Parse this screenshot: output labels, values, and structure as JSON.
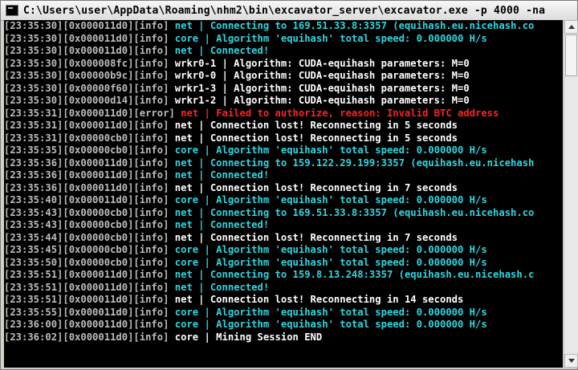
{
  "window": {
    "title": "C:\\Users\\user\\AppData\\Roaming\\nhm2\\bin\\excavator_server\\excavator.exe  -p 4000 -na"
  },
  "colors": {
    "cyan": "#2fd6e0",
    "white": "#ffffff",
    "red": "#ff2020",
    "grey": "#bdbdbd",
    "background": "#000000"
  },
  "lines": [
    {
      "prefix": "[23:35:30][0x000011d0][info]",
      "msg": "net | Connecting to 169.51.33.8:3357 (equihash.eu.nicehash.co",
      "color": "cyan"
    },
    {
      "prefix": "[23:35:30][0x000011d0][info]",
      "msg": "core | Algorithm 'equihash' total speed: 0.000000 H/s",
      "color": "cyan"
    },
    {
      "prefix": "[23:35:30][0x000011d0][info]",
      "msg": "net | Connected!",
      "color": "cyan"
    },
    {
      "prefix": "[23:35:30][0x000008fc][info]",
      "msg": "wrkr0-1 | Algorithm: CUDA-equihash parameters: M=0",
      "color": "white"
    },
    {
      "prefix": "[23:35:30][0x00000b9c][info]",
      "msg": "wrkr0-0 | Algorithm: CUDA-equihash parameters: M=0",
      "color": "white"
    },
    {
      "prefix": "[23:35:30][0x00000f60][info]",
      "msg": "wrkr1-3 | Algorithm: CUDA-equihash parameters: M=0",
      "color": "white"
    },
    {
      "prefix": "[23:35:30][0x00000d14][info]",
      "msg": "wrkr1-2 | Algorithm: CUDA-equihash parameters: M=0",
      "color": "white"
    },
    {
      "prefix": "[23:35:31][0x000011d0][error]",
      "msg": "net | Failed to authorize, reason: Invalid BTC address",
      "color": "red"
    },
    {
      "prefix": "[23:35:31][0x000011d0][info]",
      "msg": "net | Connection lost! Reconnecting in 5 seconds",
      "color": "white"
    },
    {
      "prefix": "[23:35:31][0x00000cb0][info]",
      "msg": "net | Connection lost! Reconnecting in 5 seconds",
      "color": "white"
    },
    {
      "prefix": "[23:35:35][0x00000cb0][info]",
      "msg": "core | Algorithm 'equihash' total speed: 0.000000 H/s",
      "color": "cyan"
    },
    {
      "prefix": "[23:35:36][0x000011d0][info]",
      "msg": "net | Connecting to 159.122.29.199:3357 (equihash.eu.nicehash",
      "color": "cyan"
    },
    {
      "prefix": "[23:35:36][0x000011d0][info]",
      "msg": "net | Connected!",
      "color": "cyan"
    },
    {
      "prefix": "[23:35:36][0x000011d0][info]",
      "msg": "net | Connection lost! Reconnecting in 7 seconds",
      "color": "white"
    },
    {
      "prefix": "[23:35:40][0x000011d0][info]",
      "msg": "core | Algorithm 'equihash' total speed: 0.000000 H/s",
      "color": "cyan"
    },
    {
      "prefix": "[23:35:43][0x00000cb0][info]",
      "msg": "net | Connecting to 169.51.33.8:3357 (equihash.eu.nicehash.co",
      "color": "cyan"
    },
    {
      "prefix": "[23:35:43][0x00000cb0][info]",
      "msg": "net | Connected!",
      "color": "cyan"
    },
    {
      "prefix": "[23:35:44][0x00000cb0][info]",
      "msg": "net | Connection lost! Reconnecting in 7 seconds",
      "color": "white"
    },
    {
      "prefix": "[23:35:45][0x00000cb0][info]",
      "msg": "core | Algorithm 'equihash' total speed: 0.000000 H/s",
      "color": "cyan"
    },
    {
      "prefix": "[23:35:50][0x00000cb0][info]",
      "msg": "core | Algorithm 'equihash' total speed: 0.000000 H/s",
      "color": "cyan"
    },
    {
      "prefix": "[23:35:51][0x000011d0][info]",
      "msg": "net | Connecting to 159.8.13.248:3357 (equihash.eu.nicehash.c",
      "color": "cyan"
    },
    {
      "prefix": "[23:35:51][0x000011d0][info]",
      "msg": "net | Connected!",
      "color": "cyan"
    },
    {
      "prefix": "[23:35:51][0x000011d0][info]",
      "msg": "net | Connection lost! Reconnecting in 14 seconds",
      "color": "white"
    },
    {
      "prefix": "[23:35:55][0x000011d0][info]",
      "msg": "core | Algorithm 'equihash' total speed: 0.000000 H/s",
      "color": "cyan"
    },
    {
      "prefix": "[23:36:00][0x000011d0][info]",
      "msg": "core | Algorithm 'equihash' total speed: 0.000000 H/s",
      "color": "cyan"
    },
    {
      "prefix": "[23:36:02][0x000011d0][info]",
      "msg": "core | Mining Session END",
      "color": "white"
    }
  ]
}
